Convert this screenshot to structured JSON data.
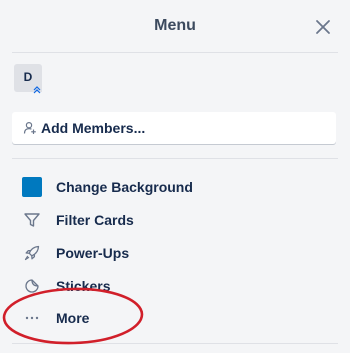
{
  "menu": {
    "title": "Menu",
    "close_icon": "close-icon"
  },
  "member": {
    "initial": "D",
    "badge_icon": "admin-chevron-icon"
  },
  "add_members": {
    "label": "Add Members...",
    "icon": "add-user-icon"
  },
  "items": [
    {
      "label": "Change Background",
      "icon": "color-swatch-icon",
      "color": "#0079bf"
    },
    {
      "label": "Filter Cards",
      "icon": "filter-icon"
    },
    {
      "label": "Power-Ups",
      "icon": "rocket-icon"
    },
    {
      "label": "Stickers",
      "icon": "sticker-icon"
    },
    {
      "label": "More",
      "icon": "more-icon"
    }
  ],
  "colors": {
    "panel_bg": "#f4f5f7",
    "text": "#172b4d",
    "icon": "#6b778c",
    "annotation_circle": "#d11f2a"
  }
}
